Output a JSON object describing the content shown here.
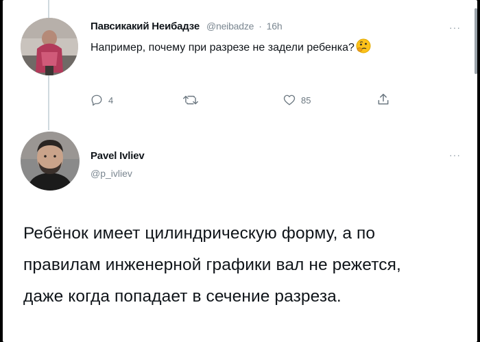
{
  "tweet1": {
    "display_name": "Павсикакий Неибадзе",
    "handle": "@neibadze",
    "separator": "·",
    "time": "16h",
    "text": "Например, почему при разрезе не задели ребенка?",
    "emoji": "thinking-face-emoji",
    "more": "···",
    "actions": {
      "reply_icon": "reply-icon",
      "reply_count": "4",
      "retweet_icon": "retweet-icon",
      "like_icon": "like-icon",
      "like_count": "85",
      "share_icon": "share-icon"
    }
  },
  "tweet2": {
    "display_name": "Pavel Ivliev",
    "handle": "@p_ivliev",
    "more": "···",
    "text": "Ребёнок имеет цилиндрическую форму, а по правилам инженерной графики вал не режется, даже когда попадает в сечение разреза."
  },
  "colors": {
    "text": "#0f1419",
    "muted": "#7a8690",
    "thread_line": "#cfd9de"
  }
}
